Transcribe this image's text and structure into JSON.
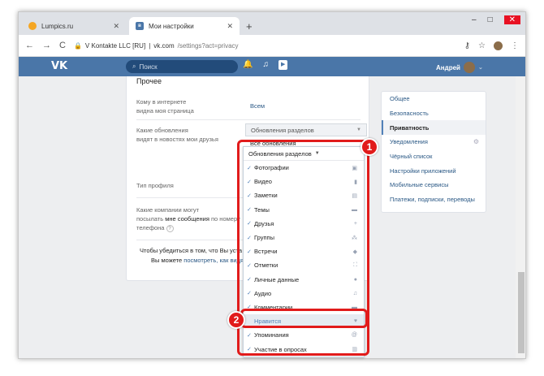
{
  "browser": {
    "tabs": [
      {
        "title": "Lumpics.ru",
        "close": "✕"
      },
      {
        "title": "Мои настройки",
        "close": "✕"
      }
    ],
    "new_tab": "+",
    "window_controls": {
      "minimize": "–",
      "maximize": "□",
      "close": "✕"
    },
    "address": {
      "site_identity": "V Kontakte LLC [RU]",
      "separator": "|",
      "url": "vk.com",
      "path": "/settings?act=privacy"
    },
    "nav": {
      "back": "←",
      "forward": "→",
      "reload": "C"
    }
  },
  "vk_header": {
    "logo": "VK",
    "search_placeholder": "Поиск",
    "user_name": "Андрей"
  },
  "settings": {
    "section_title": "Прочее",
    "rows": [
      {
        "label_line1": "Кому в интернете",
        "label_line2": "видна моя страница",
        "value": "Всем"
      },
      {
        "label_line1": "Какие обновления",
        "label_line2": "видят в новостях мои друзья",
        "value": "Обновления разделов"
      },
      {
        "label": "Тип профиля"
      },
      {
        "label_line1": "Какие компании могут",
        "label_line2a": "посылать",
        "label_line2b": "мне сообщения",
        "label_line2c": "по номеру",
        "label_line3": "телефона",
        "help": "?"
      }
    ],
    "all_updates_option": "Все обновления",
    "info_line1": "Чтобы убедиться в том, что Вы уста",
    "info_line2a": "Вы можете",
    "info_line2b": "посмотреть, как видят"
  },
  "side_menu": [
    {
      "label": "Общее"
    },
    {
      "label": "Безопасность"
    },
    {
      "label": "Приватность",
      "active": true
    },
    {
      "label": "Уведомления"
    },
    {
      "label": "Чёрный список"
    },
    {
      "label": "Настройки приложений"
    },
    {
      "label": "Мобильные сервисы"
    },
    {
      "label": "Платежи, подписки, переводы"
    }
  ],
  "dropdown": {
    "header": "Обновления разделов",
    "items": [
      {
        "label": "Фотографии",
        "checked": true,
        "icon": "camera-icon"
      },
      {
        "label": "Видео",
        "checked": true,
        "icon": "video-icon"
      },
      {
        "label": "Заметки",
        "checked": true,
        "icon": "notes-icon"
      },
      {
        "label": "Темы",
        "checked": true,
        "icon": "topics-icon"
      },
      {
        "label": "Друзья",
        "checked": true,
        "icon": "add-friend-icon"
      },
      {
        "label": "Группы",
        "checked": true,
        "icon": "groups-icon"
      },
      {
        "label": "Встречи",
        "checked": true,
        "icon": "events-icon"
      },
      {
        "label": "Отметки",
        "checked": true,
        "icon": "tags-icon"
      },
      {
        "label": "Личные данные",
        "checked": true,
        "icon": "person-icon"
      },
      {
        "label": "Аудио",
        "checked": true,
        "icon": "music-icon"
      },
      {
        "label": "Комментарии",
        "checked": true,
        "icon": "comments-icon"
      },
      {
        "label": "Нравится",
        "checked": false,
        "icon": "heart-icon",
        "highlighted": true
      },
      {
        "label": "Упоминания",
        "checked": true,
        "icon": "mention-icon"
      },
      {
        "label": "Участие в опросах",
        "checked": true,
        "icon": "polls-icon"
      }
    ]
  },
  "annotations": {
    "badge1": "1",
    "badge2": "2",
    "color": "#e11b1b"
  },
  "colors": {
    "vk_blue": "#4a76a8",
    "link": "#2a5885",
    "check": "#5181b8"
  }
}
